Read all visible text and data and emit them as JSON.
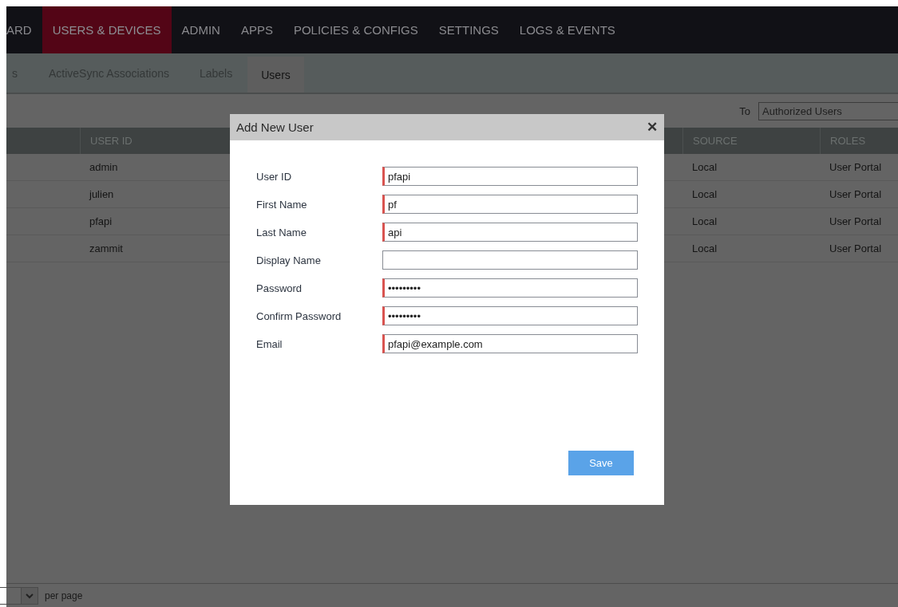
{
  "top_nav": [
    {
      "label": "ARD",
      "selected": false
    },
    {
      "label": "USERS & DEVICES",
      "selected": true
    },
    {
      "label": "ADMIN",
      "selected": false
    },
    {
      "label": "APPS",
      "selected": false
    },
    {
      "label": "POLICIES & CONFIGS",
      "selected": false
    },
    {
      "label": "SETTINGS",
      "selected": false
    },
    {
      "label": "LOGS & EVENTS",
      "selected": false
    }
  ],
  "sub_tabs": [
    {
      "label": "s",
      "selected": false
    },
    {
      "label": "ActiveSync Associations",
      "selected": false
    },
    {
      "label": "Labels",
      "selected": false
    },
    {
      "label": "Users",
      "selected": true
    }
  ],
  "toolbar": {
    "to_label": "To",
    "to_value": "Authorized Users"
  },
  "table": {
    "columns": {
      "user_id": "USER ID",
      "source": "SOURCE",
      "roles": "ROLES"
    },
    "rows": [
      {
        "user_id": "admin",
        "source": "Local",
        "roles": "User Portal"
      },
      {
        "user_id": "julien",
        "source": "Local",
        "roles": "User Portal"
      },
      {
        "user_id": "pfapi",
        "source": "Local",
        "roles": "User Portal"
      },
      {
        "user_id": "zammit",
        "source": "Local",
        "roles": "User Portal"
      }
    ]
  },
  "footer": {
    "per_page_label": "per page"
  },
  "dialog": {
    "title": "Add New User",
    "close": "✕",
    "fields": [
      {
        "label": "User ID",
        "value": "pfapi",
        "required": true
      },
      {
        "label": "First Name",
        "value": "pf",
        "required": true
      },
      {
        "label": "Last Name",
        "value": "api",
        "required": true
      },
      {
        "label": "Display Name",
        "required": false
      },
      {
        "label": "Password",
        "value": "•••••••••",
        "required": true
      },
      {
        "label": "Confirm Password",
        "value": "•••••••••",
        "required": true
      },
      {
        "label": "Email",
        "value": "pfapi@example.com",
        "required": true
      }
    ],
    "save": "Save"
  }
}
